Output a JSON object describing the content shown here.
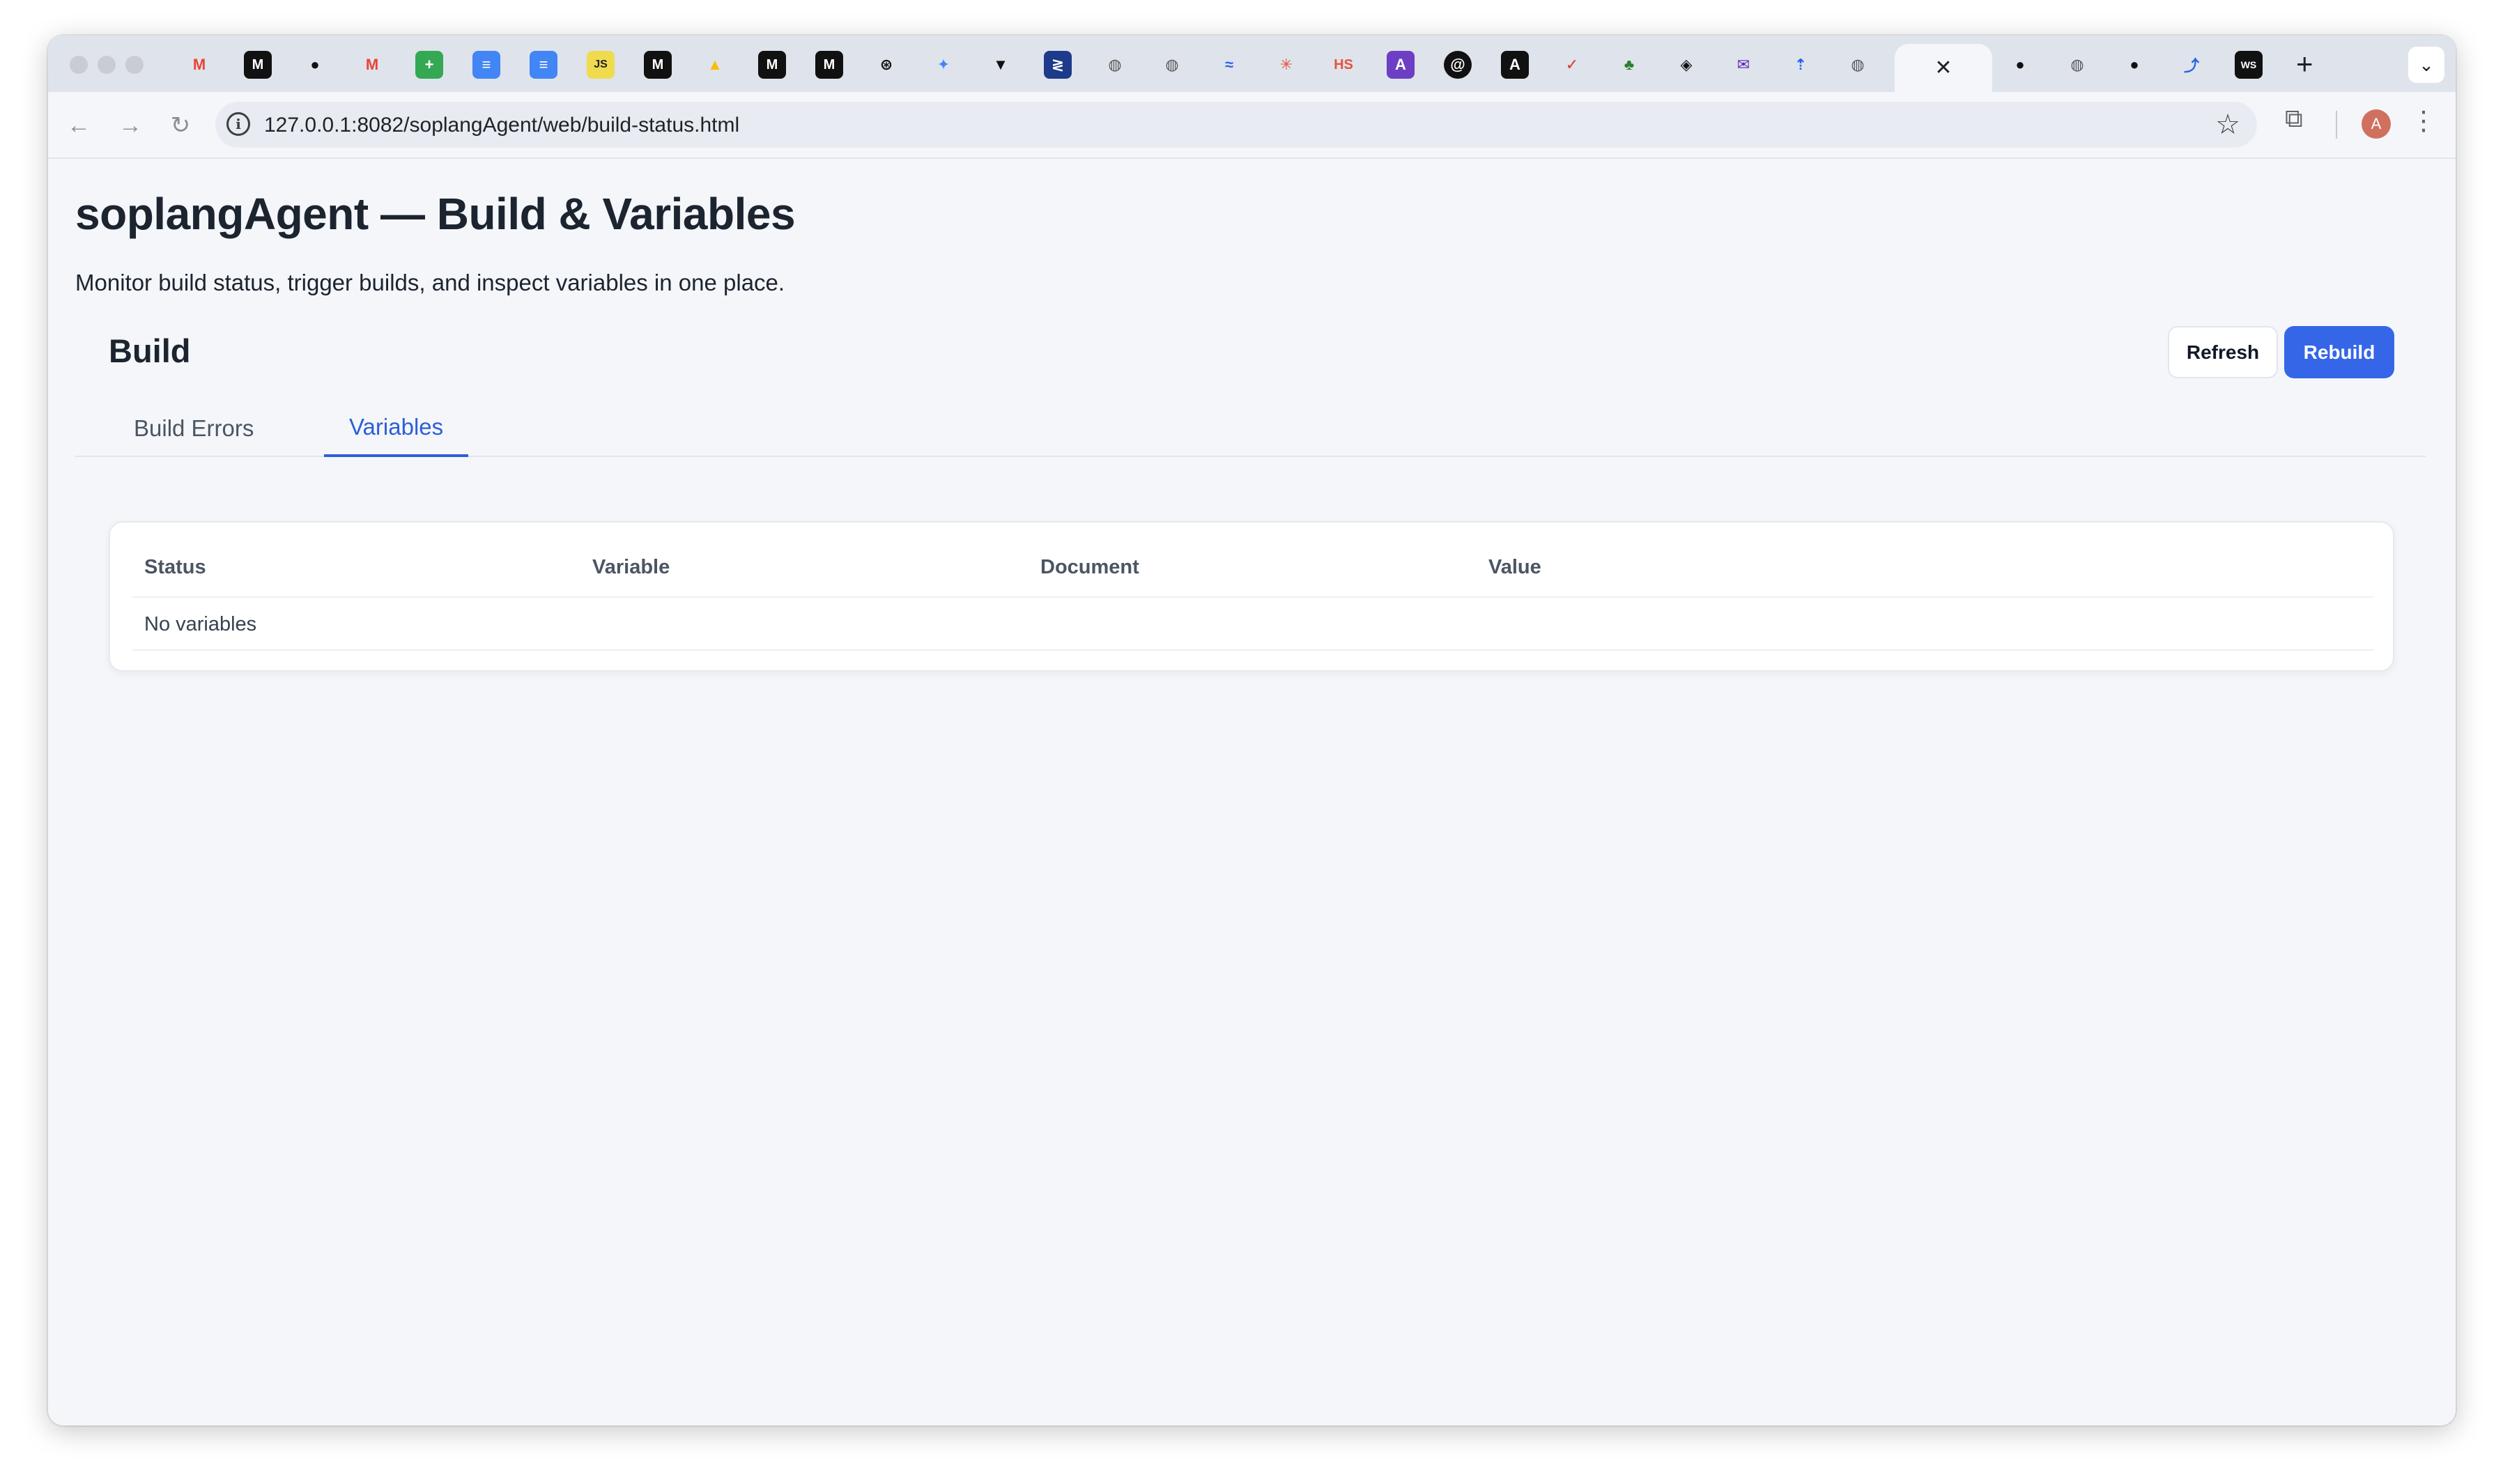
{
  "browser": {
    "url": "127.0.0.1:8082/soplangAgent/web/build-status.html",
    "avatar_initial": "A",
    "tab_favicons": [
      "gmail-icon",
      "medium-icon",
      "openai-icon",
      "gmail-icon",
      "sheets-icon",
      "docs-icon",
      "docs-icon",
      "js-icon",
      "medium-icon",
      "drive-icon",
      "medium-icon",
      "medium-icon",
      "chatgpt-icon",
      "gemini-icon",
      "scholar-icon",
      "jira-icon",
      "globe-icon",
      "globe-icon",
      "wave-icon",
      "claude-icon",
      "hs-icon",
      "notion-icon",
      "threads-icon",
      "anthropic-icon",
      "ai-icon",
      "cat-icon",
      "codepen-icon",
      "mail-icon",
      "rocket-icon",
      "globe-icon",
      "close-icon",
      "github-icon",
      "globe-icon",
      "github-icon",
      "link-icon",
      "ws-icon",
      "globe-icon"
    ]
  },
  "page": {
    "title": "soplangAgent — Build & Variables",
    "subtitle": "Monitor build status, trigger builds, and inspect variables in one place.",
    "section_title": "Build",
    "refresh_label": "Refresh",
    "rebuild_label": "Rebuild",
    "tabs": [
      {
        "label": "Build Errors",
        "active": false
      },
      {
        "label": "Variables",
        "active": true
      }
    ],
    "table": {
      "headers": [
        "Status",
        "Variable",
        "Document",
        "Value"
      ],
      "empty_message": "No variables"
    }
  },
  "colors": {
    "accent": "#3566e8",
    "active_tab": "#2d5fd8",
    "page_bg": "#f4f6f9"
  }
}
